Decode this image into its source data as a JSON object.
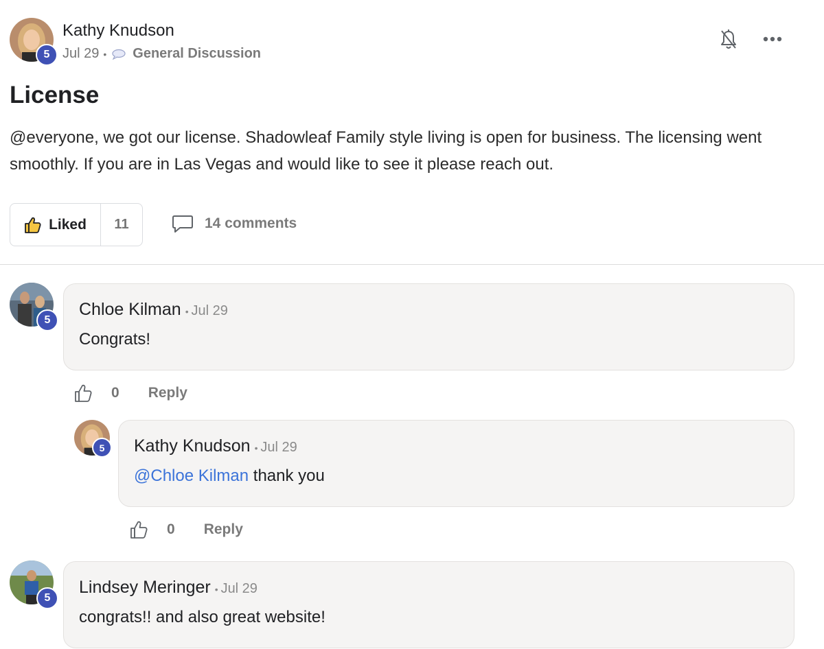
{
  "post": {
    "author": "Kathy Knudson",
    "author_level": "5",
    "date": "Jul 29",
    "category": "General Discussion",
    "title": "License",
    "body": "@everyone, we got our license. Shadowleaf Family style living is open for business. The licensing went smoothly. If you are in Las Vegas and would like to see it please reach out.",
    "liked_label": "Liked",
    "like_count": "11",
    "comments_label": "14 comments",
    "icons": {
      "notification": "bell-off-icon",
      "more": "more-horizontal-icon",
      "category": "chat-bubble-icon",
      "like": "thumbs-up-icon",
      "comments": "comment-icon"
    }
  },
  "comments": [
    {
      "author": "Chloe Kilman",
      "level": "5",
      "date": "Jul 29",
      "text": "Congrats!",
      "like_count": "0",
      "reply_label": "Reply"
    },
    {
      "author": "Kathy Knudson",
      "level": "5",
      "date": "Jul 29",
      "mention": "@Chloe Kilman",
      "text": " thank you",
      "like_count": "0",
      "reply_label": "Reply"
    },
    {
      "author": "Lindsey Meringer",
      "level": "5",
      "date": "Jul 29",
      "text": "congrats!! and also great website!"
    }
  ],
  "colors": {
    "level_badge": "#3f51b5",
    "mention": "#3b73d9",
    "comment_bg": "#f5f4f3",
    "liked_thumb": "#f4c542"
  }
}
